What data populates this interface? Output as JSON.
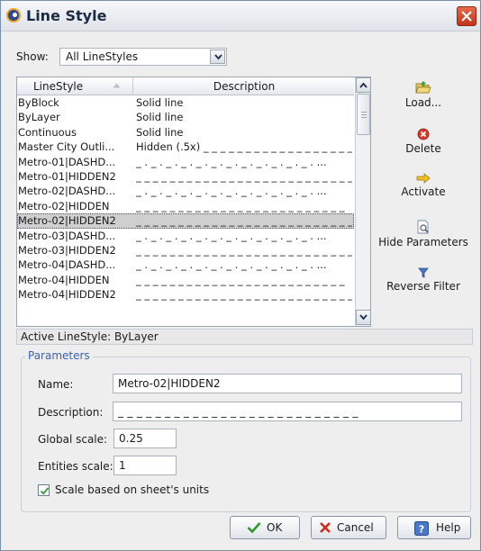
{
  "window": {
    "title": "Line Style"
  },
  "show": {
    "label": "Show:",
    "value": "All LineStyles"
  },
  "list": {
    "columns": {
      "linestyle": "LineStyle",
      "description": "Description"
    },
    "rows": [
      {
        "name": "ByBlock",
        "desc": "Solid line"
      },
      {
        "name": "ByLayer",
        "desc": "Solid line"
      },
      {
        "name": "Continuous",
        "desc": "Solid line"
      },
      {
        "name": "Master City Outli...",
        "desc": "Hidden (.5x) _ _ _ _ _ _ _ _ _ _ _ _ _ _ _ _ _ _ ..."
      },
      {
        "name": "Metro-01|DASHD...",
        "desc": "_ . _ . _ . _ . _ . _ . _ . _ . _ . _ . _ . _ . ..."
      },
      {
        "name": "Metro-01|HIDDEN2",
        "desc": "_ _ _ _ _ _ _ _ _ _ _ _ _ _ _ _ _ _ _ _ _ _ _ _ _ _ ..."
      },
      {
        "name": "Metro-02|DASHD...",
        "desc": "_ . _ . _ . _ . _ . _ . _ . _ . _ . _ . _ . _ . ..."
      },
      {
        "name": "Metro-02|HIDDEN",
        "desc": "_ _ _ _ _ _ _ _ _ _ _ _ _ _ _ _ _ _ _ _ _ _ _ _ _"
      },
      {
        "name": "Metro-02|HIDDEN2",
        "desc": "_ _ _ _ _ _ _ _ _ _ _ _ _ _ _ _ _ _ _ _ _ _ _ _ _ _ ..."
      },
      {
        "name": "Metro-03|DASHD...",
        "desc": "_ . _ . _ . _ . _ . _ . _ . _ . _ . _ . _ . _ . ..."
      },
      {
        "name": "Metro-03|HIDDEN2",
        "desc": "_ _ _ _ _ _ _ _ _ _ _ _ _ _ _ _ _ _ _ _ _ _ _ _ _ _ ..."
      },
      {
        "name": "Metro-04|DASHD...",
        "desc": "_ . _ . _ . _ . _ . _ . _ . _ . _ . _ . _ . _ . ..."
      },
      {
        "name": "Metro-04|HIDDEN",
        "desc": "_ _ _ _ _ _ _ _ _ _ _ _ _ _ _ _ _ _ _ _ _ _ _ _ _"
      },
      {
        "name": "Metro-04|HIDDEN2",
        "desc": "_ _ _ _ _ _ _ _ _ _ _ _ _ _ _ _ _ _ _ _ _ _ _ _ _ _ ..."
      }
    ],
    "selected_index": 8
  },
  "side_buttons": {
    "load": "Load...",
    "delete": "Delete",
    "activate": "Activate",
    "hide_parameters": "Hide Parameters",
    "reverse_filter": "Reverse Filter"
  },
  "active_linestyle": "Active LineStyle: ByLayer",
  "parameters": {
    "title": "Parameters",
    "name_label": "Name:",
    "name_value": "Metro-02|HIDDEN2",
    "description_label": "Description:",
    "description_value": "_ _ _ _ _ _ _ _ _ _ _ _ _ _ _ _ _ _ _ _ _ _ _ _ _ _",
    "global_scale_label": "Global scale:",
    "global_scale_value": "0.25",
    "entities_scale_label": "Entities scale:",
    "entities_scale_value": "1",
    "checkbox_label": "Scale based on sheet's units",
    "checkbox_checked": true
  },
  "buttons": {
    "ok": "OK",
    "cancel": "Cancel",
    "help": "Help"
  },
  "colors": {
    "selected_row": "#cfcfcf",
    "group_title": "#3c63a8",
    "ok_check": "#2e9a2e",
    "cancel_x": "#d02a1a",
    "close_button": "#d64a2e"
  }
}
